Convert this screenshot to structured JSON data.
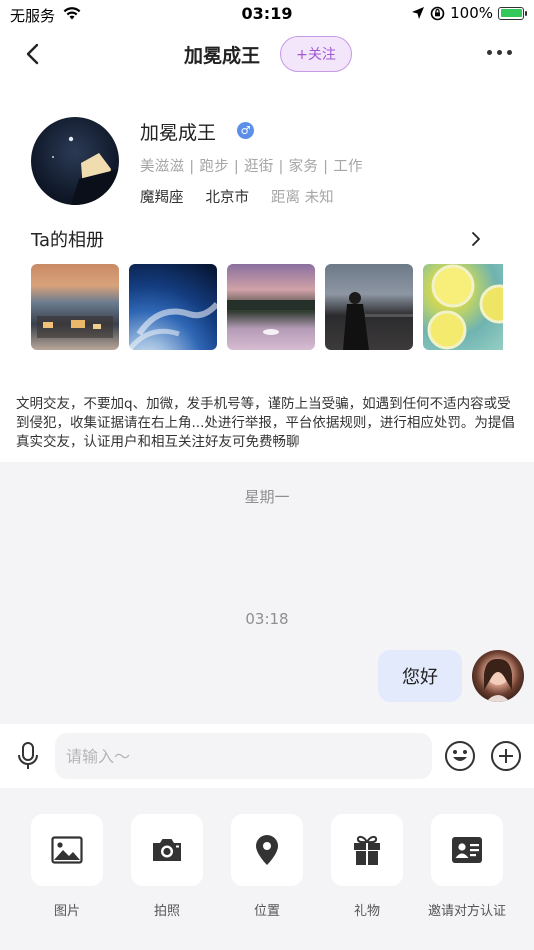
{
  "status_bar": {
    "carrier": "无服务",
    "time": "03:19",
    "battery": "100%"
  },
  "nav": {
    "title": "加冕成王",
    "follow_label": "+关注"
  },
  "profile": {
    "name": "加冕成王",
    "gender_symbol": "♂",
    "tags": "美滋滋 | 跑步 | 逛街 | 家务 | 工作",
    "zodiac": "魔羯座",
    "city": "北京市",
    "distance": "距离 未知"
  },
  "album": {
    "title": "Ta的相册"
  },
  "notice": "文明交友，不要加q、加微，发手机号等，谨防上当受骗，如遇到任何不适内容或受到侵犯，收集证据请在右上角...处进行举报，平台依据规则，进行相应处罚。为提倡真实交友，认证用户和相互关注好友可免费畅聊",
  "chat": {
    "day_label": "星期一",
    "time_label": "03:18",
    "messages": [
      {
        "text": "您好",
        "from": "me"
      }
    ]
  },
  "input": {
    "placeholder": "请输入～",
    "value": ""
  },
  "tools": [
    {
      "label": "图片",
      "icon": "image-icon"
    },
    {
      "label": "拍照",
      "icon": "camera-icon"
    },
    {
      "label": "位置",
      "icon": "location-pin-icon"
    },
    {
      "label": "礼物",
      "icon": "gift-icon"
    },
    {
      "label": "邀请对方认证",
      "icon": "id-card-icon"
    }
  ]
}
